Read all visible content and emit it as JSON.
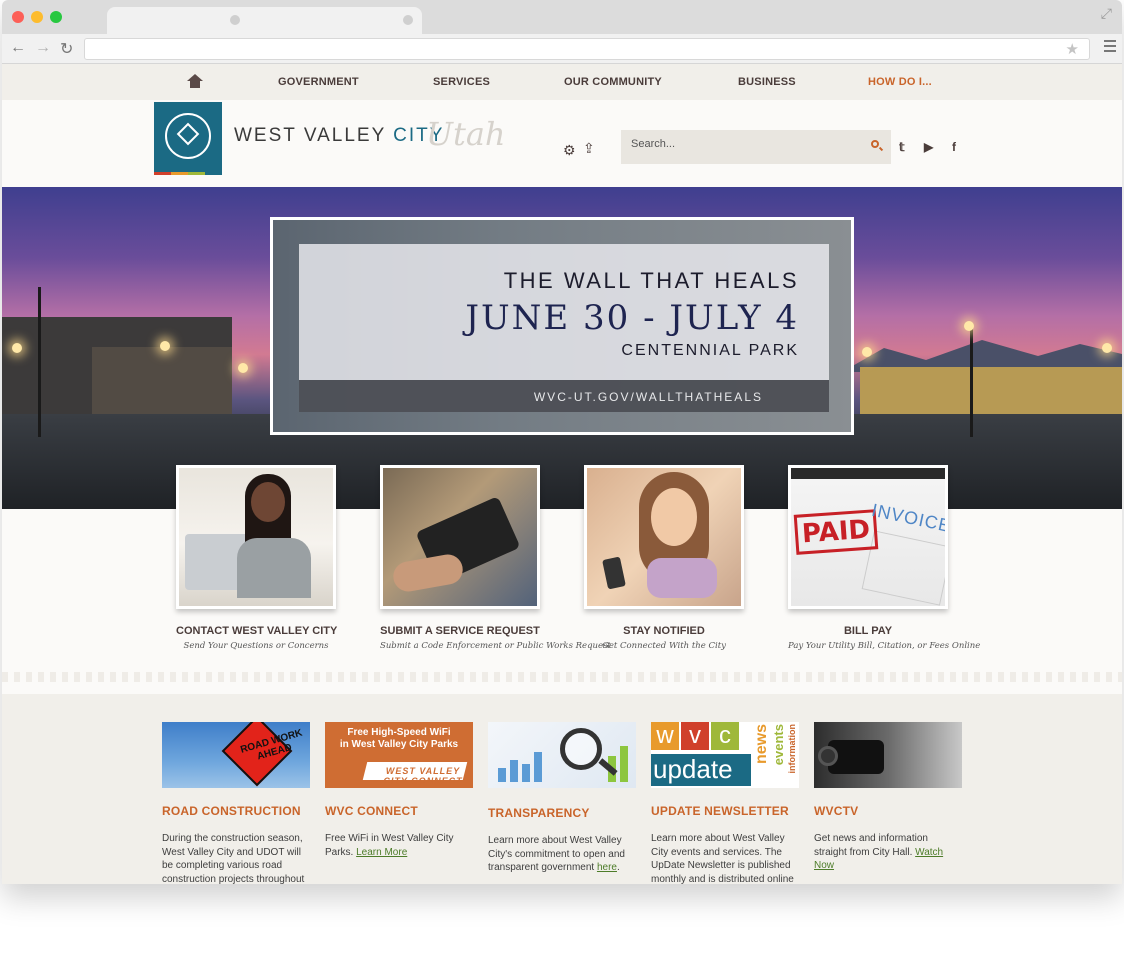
{
  "site": {
    "nav": {
      "items": [
        {
          "label": "GOVERNMENT"
        },
        {
          "label": "SERVICES"
        },
        {
          "label": "OUR COMMUNITY"
        },
        {
          "label": "BUSINESS"
        },
        {
          "label": "HOW DO I..."
        }
      ],
      "accent_color": "#c9642a"
    },
    "logo": {
      "text_main": "WEST VALLEY ",
      "text_city": "CITY",
      "script": "Utah",
      "badge_color": "#1b6a84"
    },
    "search": {
      "placeholder": "Search..."
    },
    "social": [
      "twitter-icon",
      "youtube-icon",
      "facebook-icon"
    ],
    "hero": {
      "line1": "THE WALL THAT HEALS",
      "line2": "JUNE 30 - JULY 4",
      "line3": "CENTENNIAL PARK",
      "line4": "WVC-UT.GOV/WALLTHATHEALS"
    },
    "cards": [
      {
        "title": "CONTACT WEST VALLEY CITY",
        "subtitle": "Send Your Questions or Concerns"
      },
      {
        "title": "SUBMIT A SERVICE REQUEST",
        "subtitle": "Submit a Code Enforcement or Public Works Request"
      },
      {
        "title": "STAY NOTIFIED",
        "subtitle": "Get Connected With the City"
      },
      {
        "title": "BILL PAY",
        "subtitle": "Pay Your Utility Bill, Citation, or Fees Online"
      }
    ],
    "card_images": {
      "bill_paid": "PAID",
      "bill_invoice": "INVOICE"
    },
    "features": [
      {
        "title": "ROAD CONSTRUCTION",
        "body": "During the construction season, West Valley City and UDOT will be completing various road construction projects throughout",
        "thumb_text": "ROAD WORK AHEAD"
      },
      {
        "title": "WVC CONNECT",
        "body": "Free WiFi in West Valley City Parks.",
        "link": "Learn More",
        "thumb_line1": "Free High-Speed WiFi",
        "thumb_line2": "in West Valley City Parks",
        "thumb_line3": "WEST VALLEY CITY CONNECT"
      },
      {
        "title": "TRANSPARENCY",
        "body": "Learn more about West Valley City's commitment to open and transparent government",
        "link": "here",
        "tail": "."
      },
      {
        "title": "UPDATE NEWSLETTER",
        "body": "Learn more about West Valley City events and services. The UpDate Newsletter is published monthly and is distributed online",
        "thumb_wvc": [
          "w",
          "v",
          "c"
        ],
        "thumb_update": "update",
        "thumb_news": "news",
        "thumb_events": "events",
        "thumb_info": "information"
      },
      {
        "title": "WVCTV",
        "body": "Get news and information straight from City Hall.",
        "link": "Watch Now"
      }
    ]
  }
}
